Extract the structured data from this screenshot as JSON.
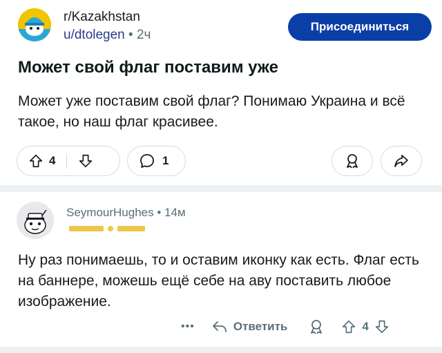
{
  "post": {
    "subreddit": "r/Kazakhstan",
    "author": "u/dtolegen",
    "separator": "•",
    "age": "2ч",
    "join_label": "Присоединиться",
    "title": "Может свой флаг поставим уже",
    "body": "Может уже поставим свой флаг? Понимаю Украина и всё такое, но наш флаг красивее.",
    "score": "4",
    "comments": "1"
  },
  "comment": {
    "user": "SeymourHughes",
    "separator": "•",
    "age": "14м",
    "body": "Ну раз понимаешь, то и оставим иконку как есть. Флаг есть на баннере, можешь ещё себе на аву поставить любое изображение.",
    "more_label": "•••",
    "reply_label": "Ответить",
    "score": "4"
  },
  "colors": {
    "join_button": "#0a3fa8",
    "subreddit_avatar": "#e8b400",
    "divider": "#eef1f3",
    "meta_text": "#576f76"
  }
}
